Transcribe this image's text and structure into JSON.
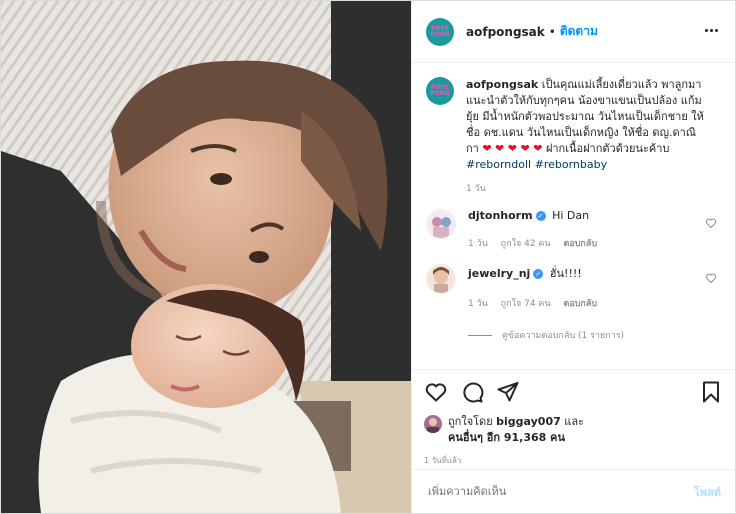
{
  "header": {
    "username": "aofpongsak",
    "separator": "•",
    "follow_label": "ติดตาม",
    "avatar_text": "POPE PONG"
  },
  "caption": {
    "username": "aofpongsak",
    "text_before_hearts1": "เป็นคุณแม่เลี้ยงเดี่ยวแล้ว พาลูกมาแนะนำตัวให้กับทุกๆคน น้องขาแขนเป็นปล้อง แก้มยุ้ย มีน้ำหนักตัวพอประมาณ วันไหนเป็นเด็กชาย ให้ชื่อ ดช.แดน วันไหนเป็นเด็กหญิง ให้ชื่อ ดญ.ดาณิกา",
    "hearts1": "❤ ❤",
    "hearts2": "❤ ❤ ❤",
    "text_after_hearts": "ฝากเนื้อฝากตัวด้วยนะค้าบ",
    "hashtag1": "#reborndoll",
    "hashtag2": "#rebornbaby",
    "time": "1 วัน"
  },
  "comments": [
    {
      "username": "djtonhorm",
      "verified": "✓",
      "text": "Hi Dan",
      "time": "1 วัน",
      "likes": "ถูกใจ 42 คน",
      "reply": "ตอบกลับ"
    },
    {
      "username": "jewelry_nj",
      "verified": "✓",
      "text": "ฮั่น!!!!",
      "time": "1 วัน",
      "likes": "ถูกใจ 74 คน",
      "reply": "ตอบกลับ"
    }
  ],
  "view_replies": "ดูข้อความตอบกลับ (1 รายการ)",
  "likes": {
    "prefix": "ถูกใจโดย",
    "user": "biggay007",
    "and": "และ",
    "others": "คนอื่นๆ อีก 91,368 คน"
  },
  "posted_ago": "1 วันที่แล้ว",
  "add_comment": {
    "placeholder": "เพิ่มความคิดเห็น",
    "post_label": "โพสต์"
  },
  "colors": {
    "accent": "#0095f6",
    "heart": "#e0112b",
    "muted": "#8e8e8e"
  }
}
